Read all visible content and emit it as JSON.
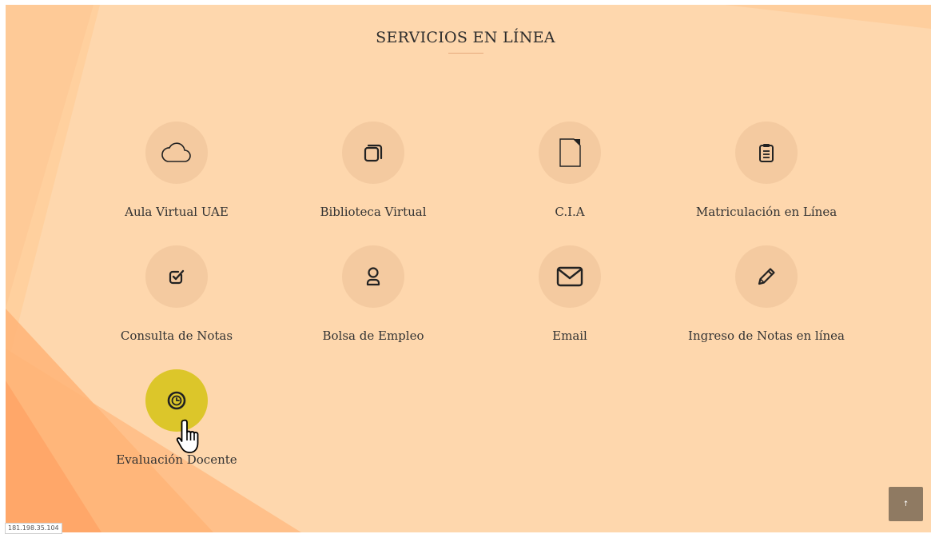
{
  "section_title": "SERVICIOS EN LÍNEA",
  "services": [
    {
      "label": "Aula Virtual UAE",
      "icon": "cloud-icon"
    },
    {
      "label": "Biblioteca Virtual",
      "icon": "stacked-copies-icon"
    },
    {
      "label": "C.I.A",
      "icon": "document-icon"
    },
    {
      "label": "Matriculación en Línea",
      "icon": "clipboard-icon"
    },
    {
      "label": "Consulta de Notas",
      "icon": "checkbox-icon"
    },
    {
      "label": "Bolsa de Empleo",
      "icon": "person-icon"
    },
    {
      "label": "Email",
      "icon": "envelope-icon"
    },
    {
      "label": "Ingreso de Notas en línea",
      "icon": "pencil-icon"
    },
    {
      "label": "Evaluación Docente",
      "icon": "clock-icon",
      "active": true
    }
  ],
  "footer": {
    "ip_address": "181.198.35.104",
    "scroll_top_label": "↑"
  },
  "colors": {
    "background": "#fed7ad",
    "icon_circle": "#f4caa0",
    "icon_circle_active": "#dcc62a",
    "scroll_button": "#8f7a62"
  }
}
